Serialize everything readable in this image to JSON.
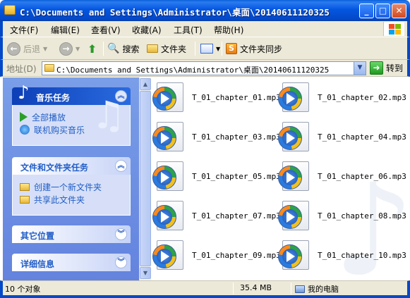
{
  "window": {
    "title": "C:\\Documents and Settings\\Administrator\\桌面\\20140611120325",
    "minimize": "_",
    "maximize": "□",
    "close": "✕"
  },
  "menu": [
    "文件(F)",
    "编辑(E)",
    "查看(V)",
    "收藏(A)",
    "工具(T)",
    "帮助(H)"
  ],
  "toolbar": {
    "back": "后退",
    "search": "搜索",
    "folders": "文件夹",
    "folder_sync": "文件夹同步"
  },
  "address": {
    "label": "地址(D)",
    "value": "C:\\Documents and Settings\\Administrator\\桌面\\20140611120325",
    "go": "转到"
  },
  "left_panels": {
    "music_tasks": {
      "title": "音乐任务",
      "items": [
        "全部播放",
        "联机购买音乐"
      ]
    },
    "file_tasks": {
      "title": "文件和文件夹任务",
      "items": [
        "创建一个新文件夹",
        "共享此文件夹"
      ]
    },
    "other_places": {
      "title": "其它位置"
    },
    "details": {
      "title": "详细信息"
    }
  },
  "files": [
    "T_01_chapter_01.mp3",
    "T_01_chapter_02.mp3",
    "T_01_chapter_03.mp3",
    "T_01_chapter_04.mp3",
    "T_01_chapter_05.mp3",
    "T_01_chapter_06.mp3",
    "T_01_chapter_07.mp3",
    "T_01_chapter_08.mp3",
    "T_01_chapter_09.mp3",
    "T_01_chapter_10.mp3"
  ],
  "status": {
    "count": "10 个对象",
    "size": "35.4 MB",
    "location": "我的电脑"
  },
  "colors": {
    "title_bar": "#0456e0",
    "task_link": "#215dc6",
    "task_pane": "#6383de"
  }
}
